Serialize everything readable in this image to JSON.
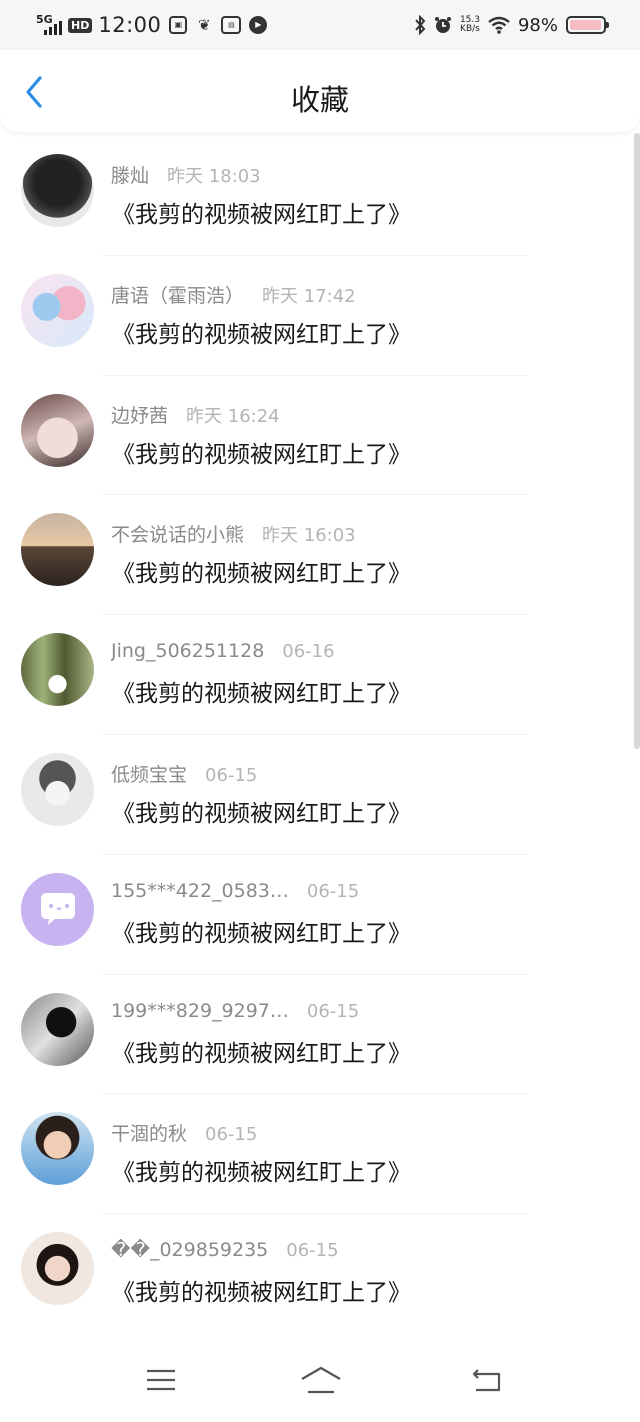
{
  "status_bar": {
    "network": "5G",
    "hd": "HD",
    "time": "12:00",
    "notification_icons": [
      "notification-box-icon",
      "notification-leaf-icon",
      "notification-news-icon",
      "notification-play-icon"
    ],
    "speed_value": "15.3",
    "speed_unit": "KB/s",
    "battery_pct": "98%",
    "battery_fill": 0.98
  },
  "header": {
    "title": "收藏"
  },
  "colors": {
    "accent": "#2e8ce6",
    "name_text": "#8a8a8a",
    "time_text": "#b4b4b4",
    "content_text": "#1a1a1a",
    "battery_fill": "#f6bec4"
  },
  "items": [
    {
      "name": "滕灿",
      "time": "昨天 18:03",
      "content": "《我剪的视频被网红盯上了》",
      "avatar": "avatar-dark-hair"
    },
    {
      "name": "唐语（霍雨浩）",
      "time": "昨天 17:42",
      "content": "《我剪的视频被网红盯上了》",
      "avatar": "avatar-anime-pink"
    },
    {
      "name": "边妤茜",
      "time": "昨天 16:24",
      "content": "《我剪的视频被网红盯上了》",
      "avatar": "avatar-portrait-light"
    },
    {
      "name": "不会说话的小熊",
      "time": "昨天 16:03",
      "content": "《我剪的视频被网红盯上了》",
      "avatar": "avatar-sunset"
    },
    {
      "name": "Jing_506251128",
      "time": "06-16",
      "content": "《我剪的视频被网红盯上了》",
      "avatar": "avatar-forest"
    },
    {
      "name": "低频宝宝",
      "time": "06-15",
      "content": "《我剪的视频被网红盯上了》",
      "avatar": "avatar-anime-gray"
    },
    {
      "name": "155***422_0583…",
      "time": "06-15",
      "content": "《我剪的视频被网红盯上了》",
      "avatar": "avatar-default-chat"
    },
    {
      "name": "199***829_9297…",
      "time": "06-15",
      "content": "《我剪的视频被网红盯上了》",
      "avatar": "avatar-mono"
    },
    {
      "name": "干涸的秋",
      "time": "06-15",
      "content": "《我剪的视频被网红盯上了》",
      "avatar": "avatar-child"
    },
    {
      "name": "��_029859235",
      "time": "06-15",
      "content": "《我剪的视频被网红盯上了》",
      "avatar": "avatar-girl"
    }
  ],
  "nav": {
    "icons": [
      "menu-icon",
      "home-icon",
      "back-icon"
    ]
  }
}
